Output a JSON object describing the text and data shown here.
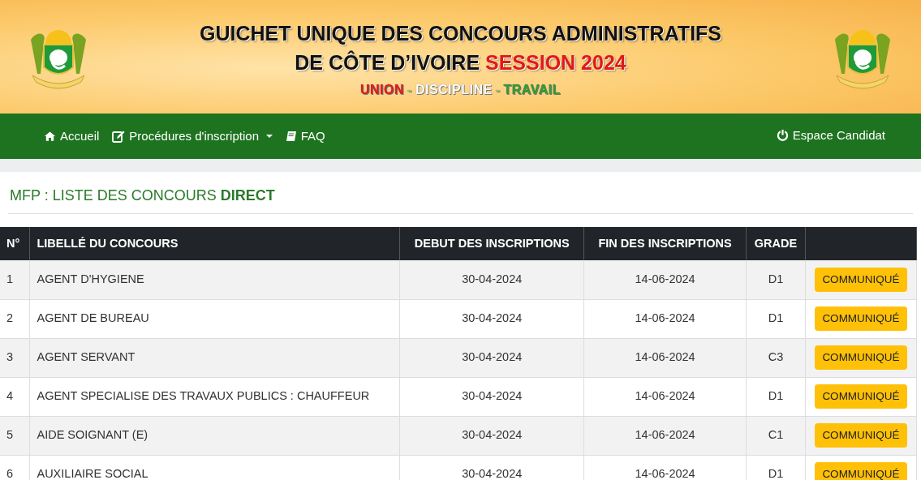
{
  "header": {
    "title_line1": "GUICHET UNIQUE DES CONCOURS ADMINISTRATIFS",
    "title_line2": "DE CÔTE D’IVOIRE",
    "title_highlight": "SESSION 2024",
    "motto": [
      {
        "text": "UNION",
        "color": "#e31b1b"
      },
      {
        "text": "-",
        "color": "#9ccc65"
      },
      {
        "text": "DISCIPLINE",
        "color": "#ffffff"
      },
      {
        "text": "-",
        "color": "#9ccc65"
      },
      {
        "text": "TRAVAIL",
        "color": "#2e9e2e"
      }
    ]
  },
  "navbar": {
    "items": [
      {
        "label": "Accueil",
        "dropdown": false
      },
      {
        "label": "Procédures d'inscription",
        "dropdown": true
      },
      {
        "label": "FAQ",
        "dropdown": false
      }
    ],
    "right_item": {
      "label": "Espace Candidat"
    }
  },
  "heading": {
    "prefix": "MFP : LISTE DES CONCOURS",
    "emphasis": "DIRECT"
  },
  "table": {
    "columns": [
      "N°",
      "LIBELLÉ DU CONCOURS",
      "DEBUT DES INSCRIPTIONS",
      "FIN DES INSCRIPTIONS",
      "GRADE"
    ],
    "rows": [
      {
        "number": "1",
        "label": "AGENT D'HYGIENE",
        "start": "30-04-2024",
        "end": "14-06-2024",
        "grade": "D1",
        "button": "COMMUNIQUÉ"
      },
      {
        "number": "2",
        "label": "AGENT DE BUREAU",
        "start": "30-04-2024",
        "end": "14-06-2024",
        "grade": "D1",
        "button": "COMMUNIQUÉ"
      },
      {
        "number": "3",
        "label": "AGENT SERVANT",
        "start": "30-04-2024",
        "end": "14-06-2024",
        "grade": "C3",
        "button": "COMMUNIQUÉ"
      },
      {
        "number": "4",
        "label": "AGENT SPECIALISE DES TRAVAUX PUBLICS : CHAUFFEUR",
        "start": "30-04-2024",
        "end": "14-06-2024",
        "grade": "D1",
        "button": "COMMUNIQUÉ"
      },
      {
        "number": "5",
        "label": "AIDE SOIGNANT (E)",
        "start": "30-04-2024",
        "end": "14-06-2024",
        "grade": "C1",
        "button": "COMMUNIQUÉ"
      },
      {
        "number": "6",
        "label": "AUXILIAIRE SOCIAL",
        "start": "30-04-2024",
        "end": "14-06-2024",
        "grade": "D1",
        "button": "COMMUNIQUÉ"
      }
    ]
  }
}
